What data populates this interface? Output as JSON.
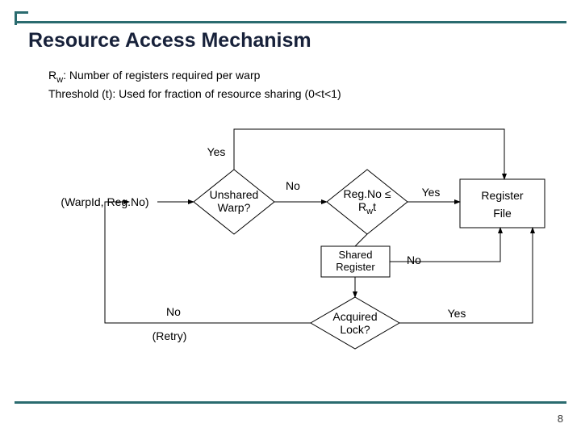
{
  "title": "Resource Access Mechanism",
  "desc": {
    "l1_pre": "R",
    "l1_sub": "w",
    "l1_post": ": Number of registers required per warp",
    "l2": "Threshold (t):  Used for fraction of resource sharing (0<t<1)"
  },
  "nodes": {
    "input": "(WarpId, Reg.No)",
    "unshared": "Unshared\nWarp?",
    "regno_l1": "Reg.No ≤",
    "regno_l2_pre": "R",
    "regno_l2_sub": "w",
    "regno_l2_post": "t",
    "regfile_l1": "Register",
    "regfile_l2": "File",
    "shared": "Shared\nRegister",
    "acquired": "Acquired\nLock?",
    "retry": "(Retry)"
  },
  "edges": {
    "yes1": "Yes",
    "no1": "No",
    "yes2": "Yes",
    "no2": "No",
    "no3": "No",
    "yes3": "Yes"
  },
  "pagenum": "8"
}
